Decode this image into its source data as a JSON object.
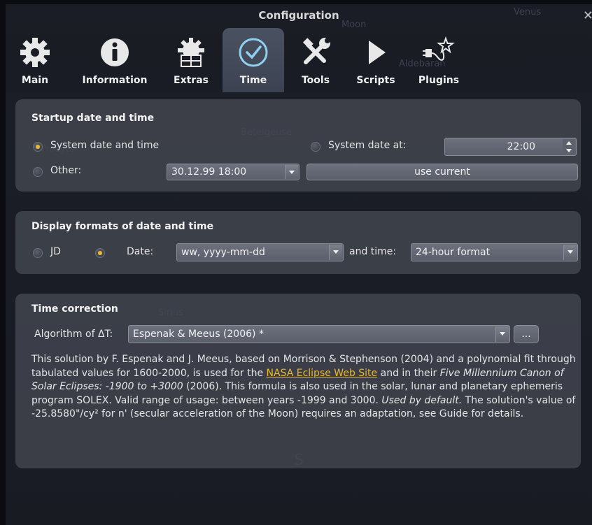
{
  "window": {
    "title": "Configuration",
    "close_glyph": "✕"
  },
  "sky_labels": [
    "Venus",
    "Moon",
    "Aldebaran",
    "Betelgeuse",
    "Procyon",
    "Sirius",
    "S"
  ],
  "tabs": [
    {
      "label": "Main",
      "icon": "gear-icon",
      "active": false
    },
    {
      "label": "Information",
      "icon": "info-icon",
      "active": false
    },
    {
      "label": "Extras",
      "icon": "extras-gear-icon",
      "active": false
    },
    {
      "label": "Time",
      "icon": "clock-icon",
      "active": true
    },
    {
      "label": "Tools",
      "icon": "tools-icon",
      "active": false
    },
    {
      "label": "Scripts",
      "icon": "play-icon",
      "active": false
    },
    {
      "label": "Plugins",
      "icon": "plugin-icon",
      "active": false
    }
  ],
  "startup": {
    "title": "Startup date and time",
    "system_label": "System date and time",
    "system_checked": true,
    "system_at_label": "System date at:",
    "system_at_value": "22:00",
    "other_label": "Other:",
    "other_value": "30.12.99 18:00",
    "use_current_label": "use current"
  },
  "formats": {
    "title": "Display formats of date and time",
    "jd_label": "JD",
    "date_label": "Date:",
    "date_value": "ww, yyyy-mm-dd",
    "time_label": "and time:",
    "time_value": "24-hour format"
  },
  "correction": {
    "title": "Time correction",
    "algo_label": "Algorithm of ΔT:",
    "algo_value": "Espenak & Meeus (2006) *",
    "more_label": "...",
    "desc_1": "This solution by F. Espenak and J. Meeus, based on Morrison & Stephenson (2004) and a polynomial fit through tabulated values for 1600-2000, is used for the ",
    "link": "NASA Eclipse Web Site",
    "desc_2": " and in their ",
    "desc_italic_1": "Five Millennium Canon of Solar Eclipses: -1900 to +3000",
    "desc_3": " (2006). This formula is also used in the solar, lunar and planetary ephemeris program SOLEX. Valid range of usage: between years -1999 and 3000. ",
    "desc_italic_2": "Used by default.",
    "desc_4": " The solution's value of -25.8580\"/cy² for n' (secular acceleration of the Moon) requires an adaptation, see Guide for details."
  },
  "colors": {
    "accent": "#e8b82e",
    "panel": "#50545e",
    "background": "#14161c"
  }
}
